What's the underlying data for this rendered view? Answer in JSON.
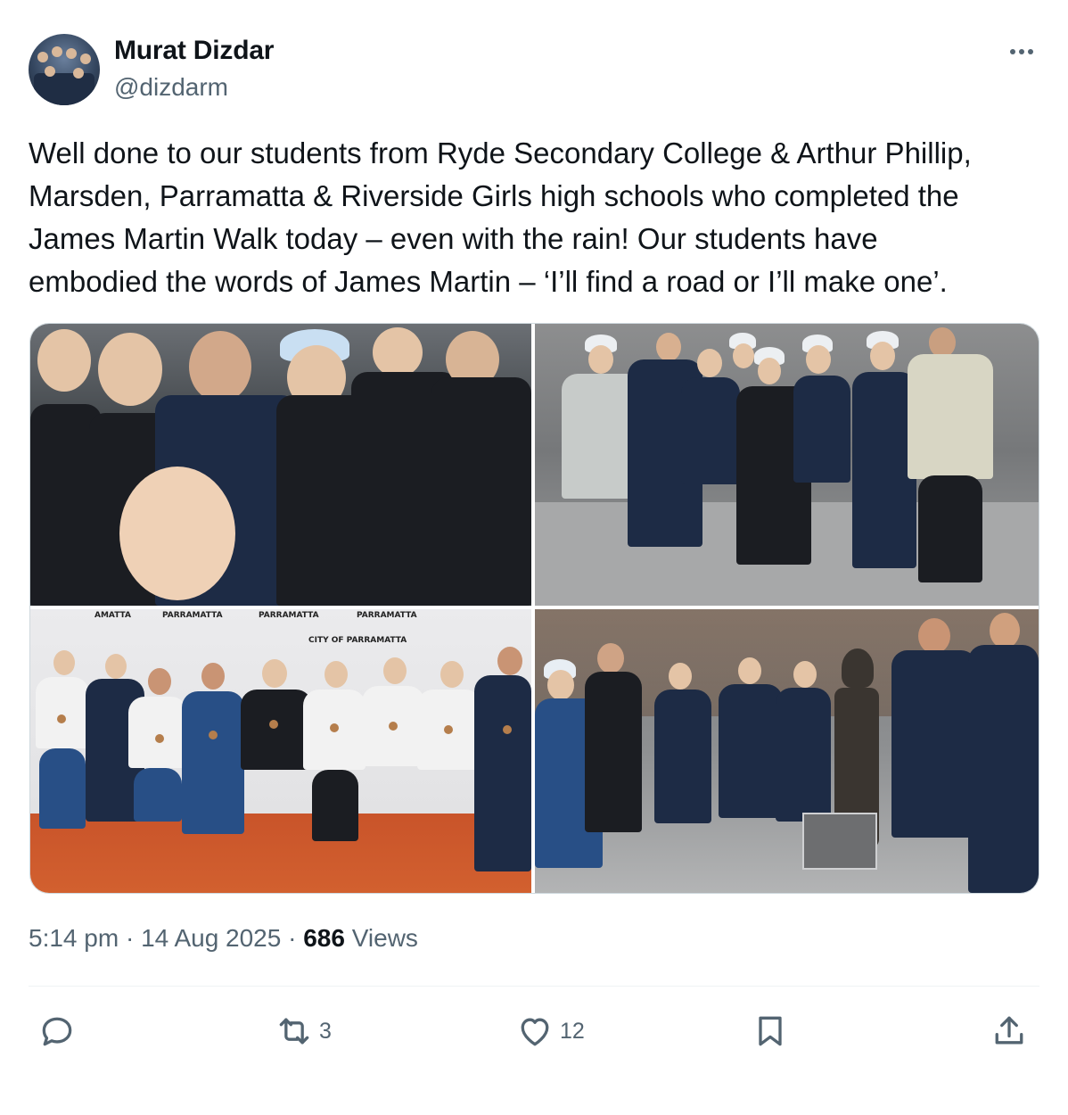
{
  "author": {
    "name": "Murat Dizdar",
    "handle": "@dizdarm",
    "avatar_icon": "group-photo-avatar"
  },
  "menu_icon": "more-horizontal-icon",
  "post": {
    "lines": [
      "Well done to our students from Ryde Secondary College & Arthur Phillip,",
      "Marsden, Parramatta & Riverside Girls high schools who completed the",
      "James Martin Walk today – even with the rain! Our students have",
      "embodied the words of James Martin –  ‘I’ll find a road or I’ll make one’."
    ]
  },
  "media": {
    "photos": [
      {
        "description": "selfie-group-photo"
      },
      {
        "description": "students-thumbs-up-square"
      },
      {
        "description": "students-with-medals"
      },
      {
        "description": "students-at-statue"
      }
    ],
    "banner_text": [
      "AMATTA",
      "PARRAMATTA",
      "PARRAMATTA",
      "PARRAMATTA",
      "CITY OF PARRAMATTA"
    ]
  },
  "meta": {
    "time": "5:14 pm",
    "separator": " · ",
    "date": "14 Aug 2025",
    "views_count": "686",
    "views_label": " Views"
  },
  "actions": {
    "reply": {
      "icon": "reply-icon",
      "count": ""
    },
    "repost": {
      "icon": "repost-icon",
      "count": "3"
    },
    "like": {
      "icon": "heart-icon",
      "count": "12"
    },
    "bookmark": {
      "icon": "bookmark-icon",
      "count": ""
    },
    "share": {
      "icon": "share-icon",
      "count": ""
    }
  },
  "colors": {
    "text": "#0f1419",
    "secondary": "#536471",
    "border": "#cfd9de"
  }
}
